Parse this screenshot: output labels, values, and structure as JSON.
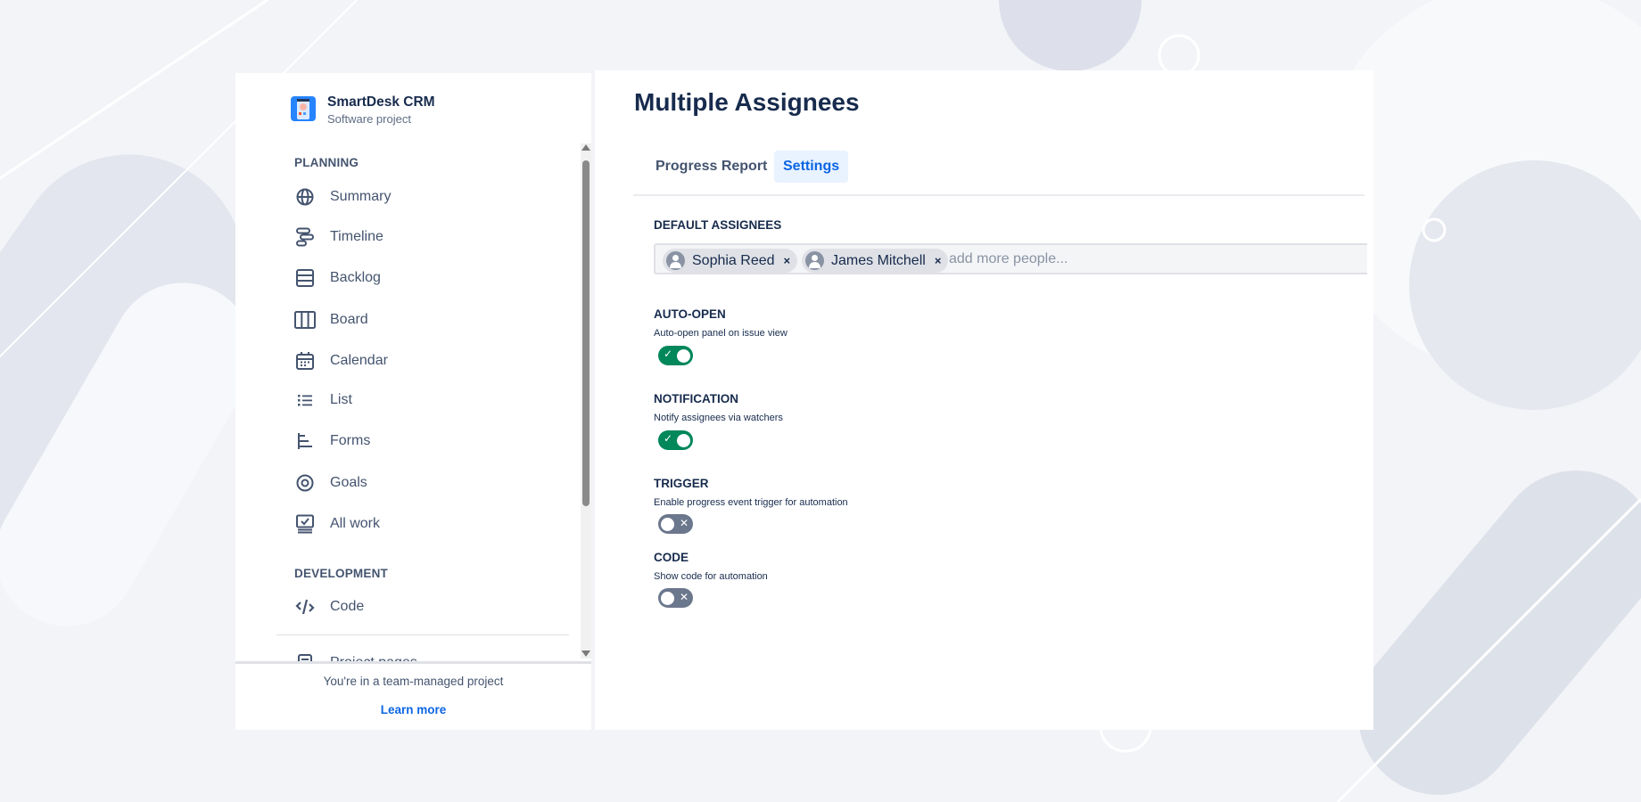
{
  "project": {
    "name": "SmartDesk CRM",
    "type": "Software project"
  },
  "sidebar": {
    "planning_label": "PLANNING",
    "planning_items": [
      {
        "label": "Summary",
        "icon": "globe-icon"
      },
      {
        "label": "Timeline",
        "icon": "timeline-icon"
      },
      {
        "label": "Backlog",
        "icon": "backlog-icon"
      },
      {
        "label": "Board",
        "icon": "board-icon"
      },
      {
        "label": "Calendar",
        "icon": "calendar-icon"
      },
      {
        "label": "List",
        "icon": "list-icon"
      },
      {
        "label": "Forms",
        "icon": "forms-icon"
      },
      {
        "label": "Goals",
        "icon": "goals-icon"
      },
      {
        "label": "All work",
        "icon": "all-work-icon"
      }
    ],
    "development_label": "DEVELOPMENT",
    "development_items": [
      {
        "label": "Code",
        "icon": "code-icon"
      }
    ],
    "extra_items": [
      {
        "label": "Project pages",
        "icon": "pages-icon"
      }
    ],
    "footer_text": "You're in a team-managed project",
    "footer_link": "Learn more"
  },
  "main": {
    "title": "Multiple Assignees",
    "tabs": [
      {
        "label": "Progress Report",
        "active": false
      },
      {
        "label": "Settings",
        "active": true
      }
    ],
    "default_assignees": {
      "label": "DEFAULT ASSIGNEES",
      "people": [
        "Sophia Reed",
        "James Mitchell"
      ],
      "remove_glyph": "×",
      "placeholder": "add more people..."
    },
    "settings": [
      {
        "label": "AUTO-OPEN",
        "description": "Auto-open panel on issue view",
        "enabled": true
      },
      {
        "label": "NOTIFICATION",
        "description": "Notify assignees via watchers",
        "enabled": true
      },
      {
        "label": "TRIGGER",
        "description": "Enable progress event trigger for automation",
        "enabled": false
      },
      {
        "label": "CODE",
        "description": "Show code for automation",
        "enabled": false
      }
    ]
  },
  "colors": {
    "toggle_on": "#00875a",
    "toggle_off": "#6b778c",
    "accent": "#0c66e4",
    "tab_active_bg": "#e9f2ff"
  }
}
